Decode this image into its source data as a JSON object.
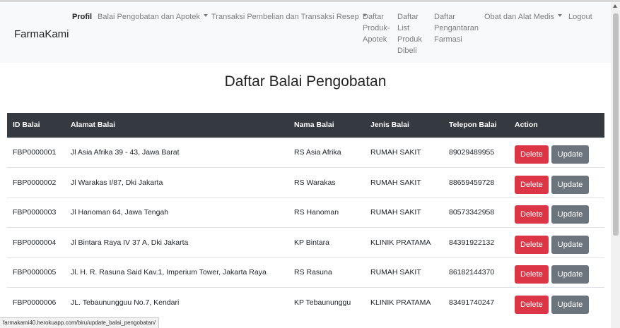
{
  "navbar": {
    "brand": "FarmaKami",
    "items": [
      {
        "label": "Profil",
        "active": true,
        "dropdown": false
      },
      {
        "label": "Balai Pengobatan dan Apotek",
        "active": false,
        "dropdown": true
      },
      {
        "label": "Transaksi Pembelian dan Transaksi Resep",
        "active": false,
        "dropdown": true
      },
      {
        "label": "Daftar Produk-Apotek",
        "active": false,
        "dropdown": false
      },
      {
        "label": "Daftar List Produk Dibeli",
        "active": false,
        "dropdown": false
      },
      {
        "label": "Daftar Pengantaran Farmasi",
        "active": false,
        "dropdown": false
      },
      {
        "label": "Obat dan Alat Medis",
        "active": false,
        "dropdown": true
      },
      {
        "label": "Logout",
        "active": false,
        "dropdown": false
      }
    ]
  },
  "page_title": "Daftar Balai Pengobatan",
  "table": {
    "headers": [
      "ID Balai",
      "Alamat Balai",
      "Nama Balai",
      "Jenis Balai",
      "Telepon Balai",
      "Action"
    ],
    "delete_label": "Delete",
    "update_label": "Update",
    "rows": [
      {
        "id": "FBP0000001",
        "alamat": "Jl Asia Afrika 39 - 43, Jawa Barat",
        "nama": "RS Asia Afrika",
        "jenis": "RUMAH SAKIT",
        "telepon": "89029489955"
      },
      {
        "id": "FBP0000002",
        "alamat": "Jl Warakas I/87, Dki Jakarta",
        "nama": "RS Warakas",
        "jenis": "RUMAH SAKIT",
        "telepon": "88659459728"
      },
      {
        "id": "FBP0000003",
        "alamat": "Jl Hanoman 64, Jawa Tengah",
        "nama": "RS Hanoman",
        "jenis": "RUMAH SAKIT",
        "telepon": "80573342958"
      },
      {
        "id": "FBP0000004",
        "alamat": "Jl Bintara Raya IV 37 A, Dki Jakarta",
        "nama": "KP Bintara",
        "jenis": "KLINIK PRATAMA",
        "telepon": "84391922132"
      },
      {
        "id": "FBP0000005",
        "alamat": "Jl. H. R. Rasuna Said Kav.1, Imperium Tower, Jakarta Raya",
        "nama": "RS Rasuna",
        "jenis": "RUMAH SAKIT",
        "telepon": "86182144370"
      },
      {
        "id": "FBP0000006",
        "alamat": "JL. Tebaunungguu No.7, Kendari",
        "nama": "KP Tebaununggu",
        "jenis": "KLINIK PRATAMA",
        "telepon": "83491740247"
      }
    ]
  },
  "status_url": "farmakami40.herokuapp.com/biru/update_balai_pengobatan/"
}
